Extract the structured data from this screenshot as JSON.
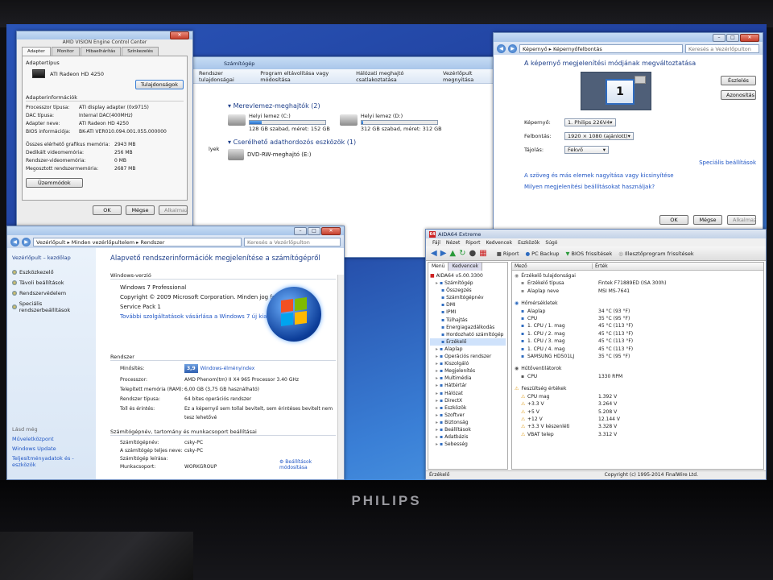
{
  "brand": "PHILIPS",
  "ccc": {
    "title": "AMD VISION Engine Control Center",
    "tabs": [
      "Adapter",
      "Monitor",
      "Hibaelhárítás",
      "Színkezelés"
    ],
    "adapter_type_label": "Adaptertípus",
    "adapter_name": "ATI Radeon HD 4250",
    "properties_button": "Tulajdonságok",
    "info_label": "Adapterinformációk",
    "rows": [
      {
        "k": "Processzor típusa:",
        "v": "ATI display adapter (0x9715)"
      },
      {
        "k": "DAC típusa:",
        "v": "Internal DAC(400MHz)"
      },
      {
        "k": "Adapter neve:",
        "v": "ATI Radeon HD 4250"
      },
      {
        "k": "BIOS információja:",
        "v": "BK-ATI VER010.094.001.055.000000"
      }
    ],
    "mem_rows": [
      {
        "k": "Összes elérhető grafikus memória:",
        "v": "2943 MB"
      },
      {
        "k": "Dedikált videomemória:",
        "v": "256 MB"
      },
      {
        "k": "Rendszer-videomemória:",
        "v": "0 MB"
      },
      {
        "k": "Megosztott rendszermemória:",
        "v": "2687 MB"
      }
    ],
    "list_modes_button": "Üzemmódok",
    "ok": "OK",
    "cancel": "Mégse",
    "apply": "Alkalmaz"
  },
  "explorer": {
    "menu": [
      "Rendszer tulajdonságai",
      "Program eltávolítása vagy módosítása",
      "Hálózati meghajtó csatlakoztatása",
      "Vezérlőpult megnyitása"
    ],
    "breadcrumb": "Számítógép",
    "hard_drives_header": "Merevlemez-meghajtók (2)",
    "drives": [
      {
        "name": "Helyi lemez (C:)",
        "free": "128 GB szabad, méret: 152 GB",
        "fill": 0.16
      },
      {
        "name": "Helyi lemez (D:)",
        "free": "312 GB szabad, méret: 312 GB",
        "fill": 0.02
      }
    ],
    "removable_header": "Cserélhető adathordozós eszközök (1)",
    "dvd": "DVD-RW-meghajtó (E:)",
    "side_labels": [
      "lyek"
    ]
  },
  "display": {
    "address": "Képernyő ▸ Képernyőfelbontás",
    "search": "Keresés a Vezérlőpulton",
    "heading": "A képernyő megjelenítési módjának megváltoztatása",
    "monitor_number": "1",
    "detect_button": "Észlelés",
    "identify_button": "Azonosítás",
    "fields": [
      {
        "label": "Képernyő:",
        "value": "1. Philips 226V4"
      },
      {
        "label": "Felbontás:",
        "value": "1920 × 1080 (ajánlott)"
      },
      {
        "label": "Tájolás:",
        "value": "Fekvő"
      }
    ],
    "advanced_link": "Speciális beállítások",
    "link1": "A szöveg és más elemek nagyítása vagy kicsinyítése",
    "link2": "Milyen megjelenítési beállításokat használjak?",
    "ok": "OK",
    "cancel": "Mégse",
    "apply": "Alkalmaz"
  },
  "system": {
    "address": "Vezérlőpult ▸ Minden vezérlőpultelem ▸ Rendszer",
    "search": "Keresés a Vezérlőpulton",
    "side_title": "Vezérlőpult – kezdőlap",
    "side_links": [
      "Eszközkezelő",
      "Távoli beállítások",
      "Rendszervédelem",
      "Speciális rendszerbeállítások"
    ],
    "see_also": "Lásd még",
    "bottom_links": [
      "Műveletközpont",
      "Windows Update",
      "Teljesítményadatok és -eszközök"
    ],
    "heading": "Alapvető rendszerinformációk megjelenítése a számítógépről",
    "edition_title": "Windows-verzió",
    "edition": "Windows 7 Professional",
    "copyright": "Copyright © 2009 Microsoft Corporation. Minden jog fenntartva.",
    "sp": "Service Pack 1",
    "sp_link": "További szolgáltatások vásárlása a Windows 7 új kiadásával",
    "system_title": "Rendszer",
    "rows": [
      {
        "k": "Minősítés:",
        "v": "Windows-élményindex"
      },
      {
        "k": "Processzor:",
        "v": "AMD Phenom(tm) II X4 965 Processor   3.40 GHz"
      },
      {
        "k": "Telepített memória (RAM):",
        "v": "6,00 GB (3,75 GB használható)"
      },
      {
        "k": "Rendszer típusa:",
        "v": "64 bites operációs rendszer"
      },
      {
        "k": "Toll és érintés:",
        "v": "Ez a képernyő sem tollal bevitelt, sem érintéses bevitelt nem tesz lehetővé"
      }
    ],
    "rating": "3,9",
    "computer_title": "Számítógépnév, tartomány és munkacsoport beállításai",
    "comp_rows": [
      {
        "k": "Számítógépnév:",
        "v": "csky-PC"
      },
      {
        "k": "A számítógép teljes neve:",
        "v": "csky-PC"
      },
      {
        "k": "Számítógép leírása:",
        "v": ""
      },
      {
        "k": "Munkacsoport:",
        "v": "WORKGROUP"
      }
    ],
    "change_settings": "Beállítások módosítása"
  },
  "aida": {
    "title": "AIDA64 Extreme",
    "menu": [
      "Fájl",
      "Nézet",
      "Riport",
      "Kedvencek",
      "Eszközök",
      "Súgó"
    ],
    "toolbar": [
      "Riport",
      "PC Backup",
      "BIOS frissítések",
      "Illesztőprogram frissítések"
    ],
    "tabs": [
      "Menü",
      "Kedvencek"
    ],
    "tree": [
      {
        "t": "AIDA64 v5.00.3300",
        "l": 0
      },
      {
        "t": "Számítógép",
        "l": 1
      },
      {
        "t": "Összegzés",
        "l": 2
      },
      {
        "t": "Számítógépnév",
        "l": 2
      },
      {
        "t": "DMI",
        "l": 2
      },
      {
        "t": "IPMI",
        "l": 2
      },
      {
        "t": "Túlhajtás",
        "l": 2
      },
      {
        "t": "Energiagazdálkodás",
        "l": 2
      },
      {
        "t": "Hordozható számítógép",
        "l": 2
      },
      {
        "t": "Érzékelő",
        "l": 2
      },
      {
        "t": "Alaplap",
        "l": 1
      },
      {
        "t": "Operációs rendszer",
        "l": 1
      },
      {
        "t": "Kiszolgáló",
        "l": 1
      },
      {
        "t": "Megjelenítés",
        "l": 1
      },
      {
        "t": "Multimédia",
        "l": 1
      },
      {
        "t": "Háttértár",
        "l": 1
      },
      {
        "t": "Hálózat",
        "l": 1
      },
      {
        "t": "DirectX",
        "l": 1
      },
      {
        "t": "Eszközök",
        "l": 1
      },
      {
        "t": "Szoftver",
        "l": 1
      },
      {
        "t": "Biztonság",
        "l": 1
      },
      {
        "t": "Beállítások",
        "l": 1
      },
      {
        "t": "Adatbázis",
        "l": 1
      },
      {
        "t": "Sebesség",
        "l": 1
      }
    ],
    "col_field": "Mező",
    "col_value": "Érték",
    "sections": [
      {
        "h": "Érzékelő tulajdonságai",
        "rows": [
          {
            "k": "Érzékelő típusa",
            "v": "Fintek F71889ED  (ISA 300h)"
          },
          {
            "k": "Alaplap neve",
            "v": "MSI MS-7641"
          }
        ]
      },
      {
        "h": "Hőmérsékletek",
        "rows": [
          {
            "k": "Alaplap",
            "v": "34 °C  (93 °F)"
          },
          {
            "k": "CPU",
            "v": "35 °C  (95 °F)"
          },
          {
            "k": "1. CPU / 1. mag",
            "v": "45 °C  (113 °F)"
          },
          {
            "k": "1. CPU / 2. mag",
            "v": "45 °C  (113 °F)"
          },
          {
            "k": "1. CPU / 3. mag",
            "v": "45 °C  (113 °F)"
          },
          {
            "k": "1. CPU / 4. mag",
            "v": "45 °C  (113 °F)"
          },
          {
            "k": "SAMSUNG HD501LJ",
            "v": "35 °C  (95 °F)"
          }
        ]
      },
      {
        "h": "Hűtőventilátorok",
        "rows": [
          {
            "k": "CPU",
            "v": "1330 RPM"
          }
        ]
      },
      {
        "h": "Feszültség értékek",
        "rows": [
          {
            "k": "CPU mag",
            "v": "1.392 V"
          },
          {
            "k": "+3.3 V",
            "v": "3.264 V"
          },
          {
            "k": "+5 V",
            "v": "5.208 V"
          },
          {
            "k": "+12 V",
            "v": "12.144 V"
          },
          {
            "k": "+3.3 V készenléti",
            "v": "3.328 V"
          },
          {
            "k": "VBAT telep",
            "v": "3.312 V"
          }
        ]
      }
    ],
    "status_left": "Érzékelő",
    "status_right": "Copyright (c) 1995-2014 FinalWire Ltd."
  }
}
